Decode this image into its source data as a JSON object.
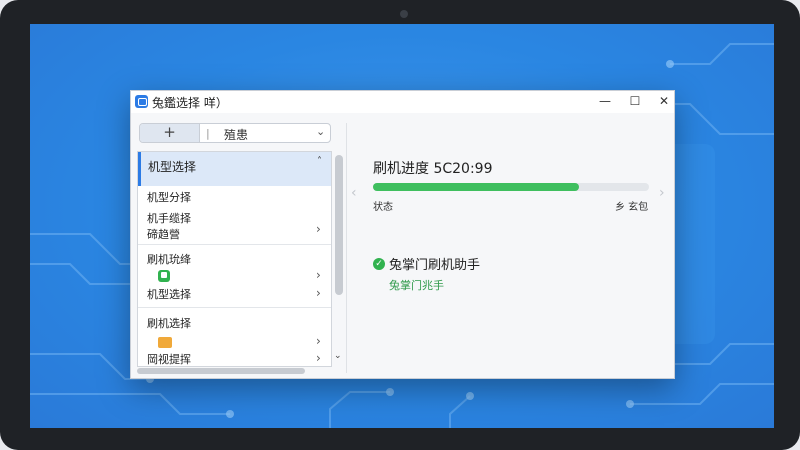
{
  "window": {
    "title": "兔鑑选择 咩）",
    "controls": {
      "minimize": "—",
      "maximize": "☐",
      "close": "✕"
    }
  },
  "toolbar": {
    "add_label": "+",
    "separator": "|",
    "dropdown_value": "殖患"
  },
  "sidebar": {
    "header": "机型选择",
    "group1": [
      "机型分择",
      "机手缆择",
      "碲趋營"
    ],
    "group2": [
      "刷机玧绛",
      "机型选择"
    ],
    "group3": [
      "刷机选择",
      "岡视提挥"
    ]
  },
  "progress": {
    "title": "刷机进度 5C20:99",
    "value": 0.745,
    "status_label": "状态",
    "status_value": "乡 玄包"
  },
  "helper": {
    "title": "兔掌门刷机助手",
    "link": "兔掌门兆手"
  },
  "colors": {
    "accent": "#2c7be5",
    "success": "#3fbf5f",
    "link_green": "#2f9a4a"
  }
}
